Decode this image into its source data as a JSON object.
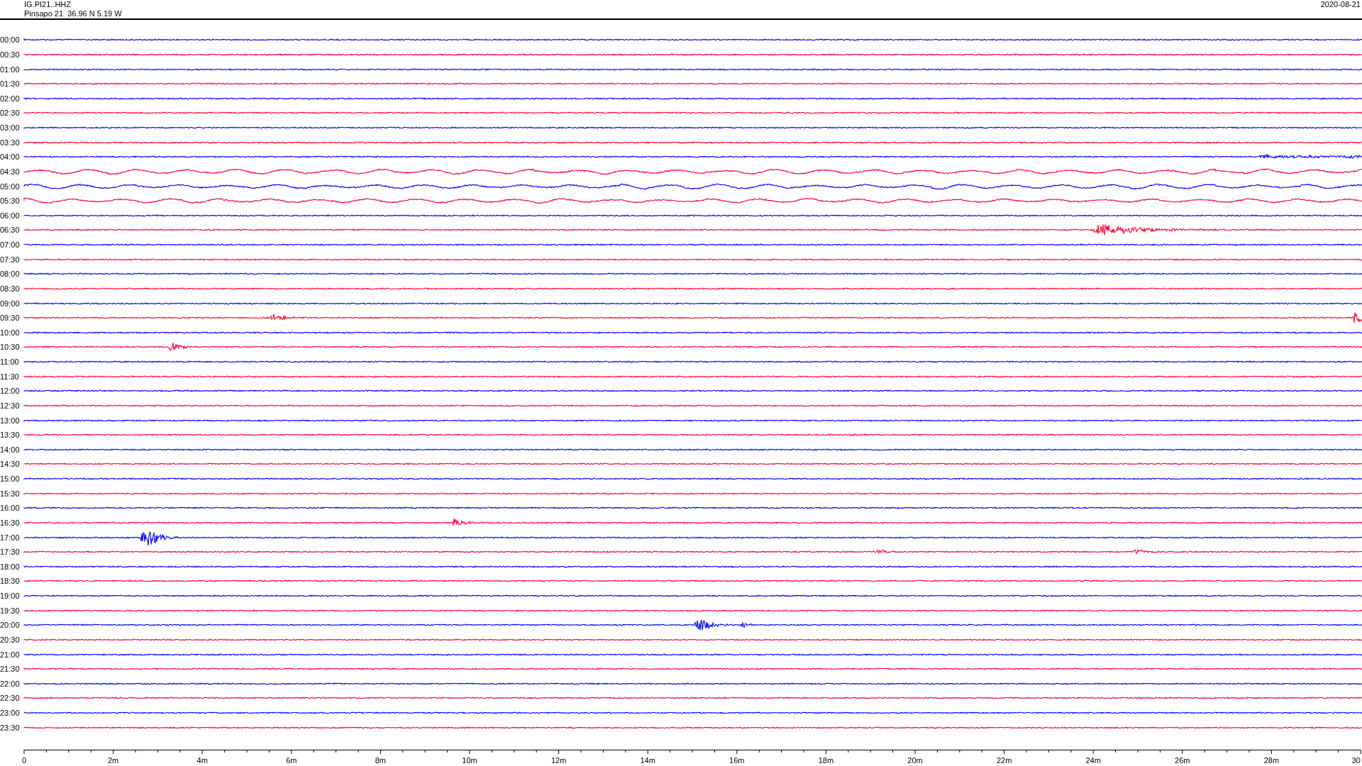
{
  "header": {
    "station": "IG.PI21..HHZ",
    "location": "Pinsapo 21  36.96 N 5.19 W",
    "date": "2020-08-21"
  },
  "rows": [
    {
      "time": "00:00",
      "color": "#0000ff"
    },
    {
      "time": "00:30",
      "color": "#ff0033"
    },
    {
      "time": "01:00",
      "color": "#0000ff"
    },
    {
      "time": "01:30",
      "color": "#ff0033"
    },
    {
      "time": "02:00",
      "color": "#0000ff"
    },
    {
      "time": "02:30",
      "color": "#ff0033"
    },
    {
      "time": "03:00",
      "color": "#0000ff"
    },
    {
      "time": "03:30",
      "color": "#ff0033"
    },
    {
      "time": "04:00",
      "color": "#0000ff"
    },
    {
      "time": "04:30",
      "color": "#ff0033"
    },
    {
      "time": "05:00",
      "color": "#0000ff"
    },
    {
      "time": "05:30",
      "color": "#ff0033"
    },
    {
      "time": "06:00",
      "color": "#0000ff"
    },
    {
      "time": "06:30",
      "color": "#ff0033"
    },
    {
      "time": "07:00",
      "color": "#0000ff"
    },
    {
      "time": "07:30",
      "color": "#ff0033"
    },
    {
      "time": "08:00",
      "color": "#0000ff"
    },
    {
      "time": "08:30",
      "color": "#ff0033"
    },
    {
      "time": "09:00",
      "color": "#0000ff"
    },
    {
      "time": "09:30",
      "color": "#ff0033"
    },
    {
      "time": "10:00",
      "color": "#0000ff"
    },
    {
      "time": "10:30",
      "color": "#ff0033"
    },
    {
      "time": "11:00",
      "color": "#0000ff"
    },
    {
      "time": "11:30",
      "color": "#ff0033"
    },
    {
      "time": "12:00",
      "color": "#0000ff"
    },
    {
      "time": "12:30",
      "color": "#ff0033"
    },
    {
      "time": "13:00",
      "color": "#0000ff"
    },
    {
      "time": "13:30",
      "color": "#ff0033"
    },
    {
      "time": "14:00",
      "color": "#0000ff"
    },
    {
      "time": "14:30",
      "color": "#ff0033"
    },
    {
      "time": "15:00",
      "color": "#0000ff"
    },
    {
      "time": "15:30",
      "color": "#ff0033"
    },
    {
      "time": "16:00",
      "color": "#0000ff"
    },
    {
      "time": "16:30",
      "color": "#ff0033"
    },
    {
      "time": "17:00",
      "color": "#0000ff"
    },
    {
      "time": "17:30",
      "color": "#ff0033"
    },
    {
      "time": "18:00",
      "color": "#0000ff"
    },
    {
      "time": "18:30",
      "color": "#ff0033"
    },
    {
      "time": "19:00",
      "color": "#0000ff"
    },
    {
      "time": "19:30",
      "color": "#ff0033"
    },
    {
      "time": "20:00",
      "color": "#0000ff"
    },
    {
      "time": "20:30",
      "color": "#ff0033"
    },
    {
      "time": "21:00",
      "color": "#0000ff"
    },
    {
      "time": "21:30",
      "color": "#ff0033"
    },
    {
      "time": "22:00",
      "color": "#0000ff"
    },
    {
      "time": "22:30",
      "color": "#ff0033"
    },
    {
      "time": "23:00",
      "color": "#0000ff"
    },
    {
      "time": "23:30",
      "color": "#ff0033"
    }
  ],
  "axis": {
    "labels": [
      "0",
      "2m",
      "4m",
      "6m",
      "8m",
      "10m",
      "12m",
      "14m",
      "16m",
      "18m",
      "20m",
      "22m",
      "24m",
      "26m",
      "28m",
      "30"
    ]
  }
}
